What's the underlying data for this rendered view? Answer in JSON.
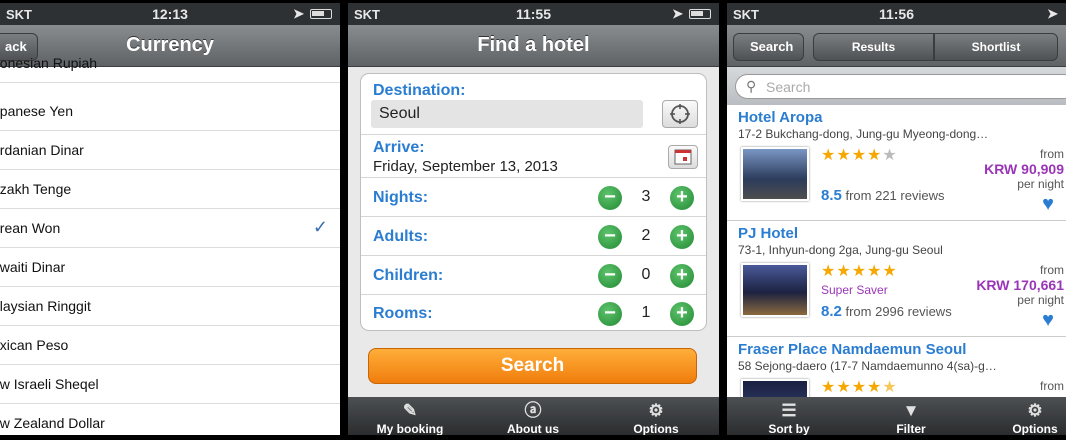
{
  "phone1": {
    "status": {
      "carrier": "SKT",
      "time": "12:13"
    },
    "nav": {
      "back_label": "ack",
      "title": "Currency"
    },
    "partial_top": "donesian Rupiah",
    "items": [
      {
        "label": "apanese Yen"
      },
      {
        "label": "ordanian Dinar"
      },
      {
        "label": "azakh Tenge"
      },
      {
        "label": "orean Won",
        "checked": true
      },
      {
        "label": "uwaiti Dinar"
      },
      {
        "label": "alaysian Ringgit"
      },
      {
        "label": "exican Peso"
      },
      {
        "label": "ew Israeli Sheqel"
      },
      {
        "label": "ew Zealand Dollar"
      }
    ],
    "check_glyph": "✓"
  },
  "phone2": {
    "status": {
      "carrier": "SKT",
      "time": "11:55"
    },
    "nav": {
      "title": "Find a hotel"
    },
    "destination": {
      "label": "Destination:",
      "value": "Seoul"
    },
    "arrive": {
      "label": "Arrive:",
      "value": "Friday, September 13, 2013"
    },
    "nights": {
      "label": "Nights:",
      "value": "3"
    },
    "adults": {
      "label": "Adults:",
      "value": "2"
    },
    "children": {
      "label": "Children:",
      "value": "0"
    },
    "rooms": {
      "label": "Rooms:",
      "value": "1"
    },
    "search_label": "Search",
    "tabs": [
      {
        "label": "My booking",
        "icon": "pencil-icon"
      },
      {
        "label": "About us",
        "icon": "circle-a-icon"
      },
      {
        "label": "Options",
        "icon": "gear-icon"
      }
    ]
  },
  "phone3": {
    "status": {
      "carrier": "SKT",
      "time": "11:56"
    },
    "nav": {
      "back_label": "Search",
      "segments": [
        "Results",
        "Shortlist"
      ]
    },
    "search_placeholder": "Search",
    "hotels": [
      {
        "name": "Hotel Aropa",
        "address": "17-2 Bukchang-dong, Jung-gu  Myeong-dong…",
        "stars": 4,
        "from": "from",
        "price": "KRW 90,909",
        "per_night": "per night",
        "score": "8.5",
        "reviews": "from 221 reviews",
        "tag": ""
      },
      {
        "name": "PJ Hotel",
        "address": "73-1, Inhyun-dong 2ga, Jung-gu  Seoul",
        "stars": 5,
        "from": "from",
        "price": "KRW 170,661",
        "per_night": "per night",
        "score": "8.2",
        "reviews": "from 2996 reviews",
        "tag": "Super Saver"
      },
      {
        "name": "Fraser Place Namdaemun Seoul",
        "address": "58 Sejong-daero (17-7 Namdaemunno 4(sa)-g…",
        "stars": 4.5,
        "from": "from",
        "price": "",
        "per_night": "",
        "score": "",
        "reviews": "",
        "tag": ""
      }
    ],
    "tabs": [
      {
        "label": "Sort by",
        "icon": "list-icon"
      },
      {
        "label": "Filter",
        "icon": "filter-icon"
      },
      {
        "label": "Options",
        "icon": "gear-icon"
      }
    ]
  }
}
